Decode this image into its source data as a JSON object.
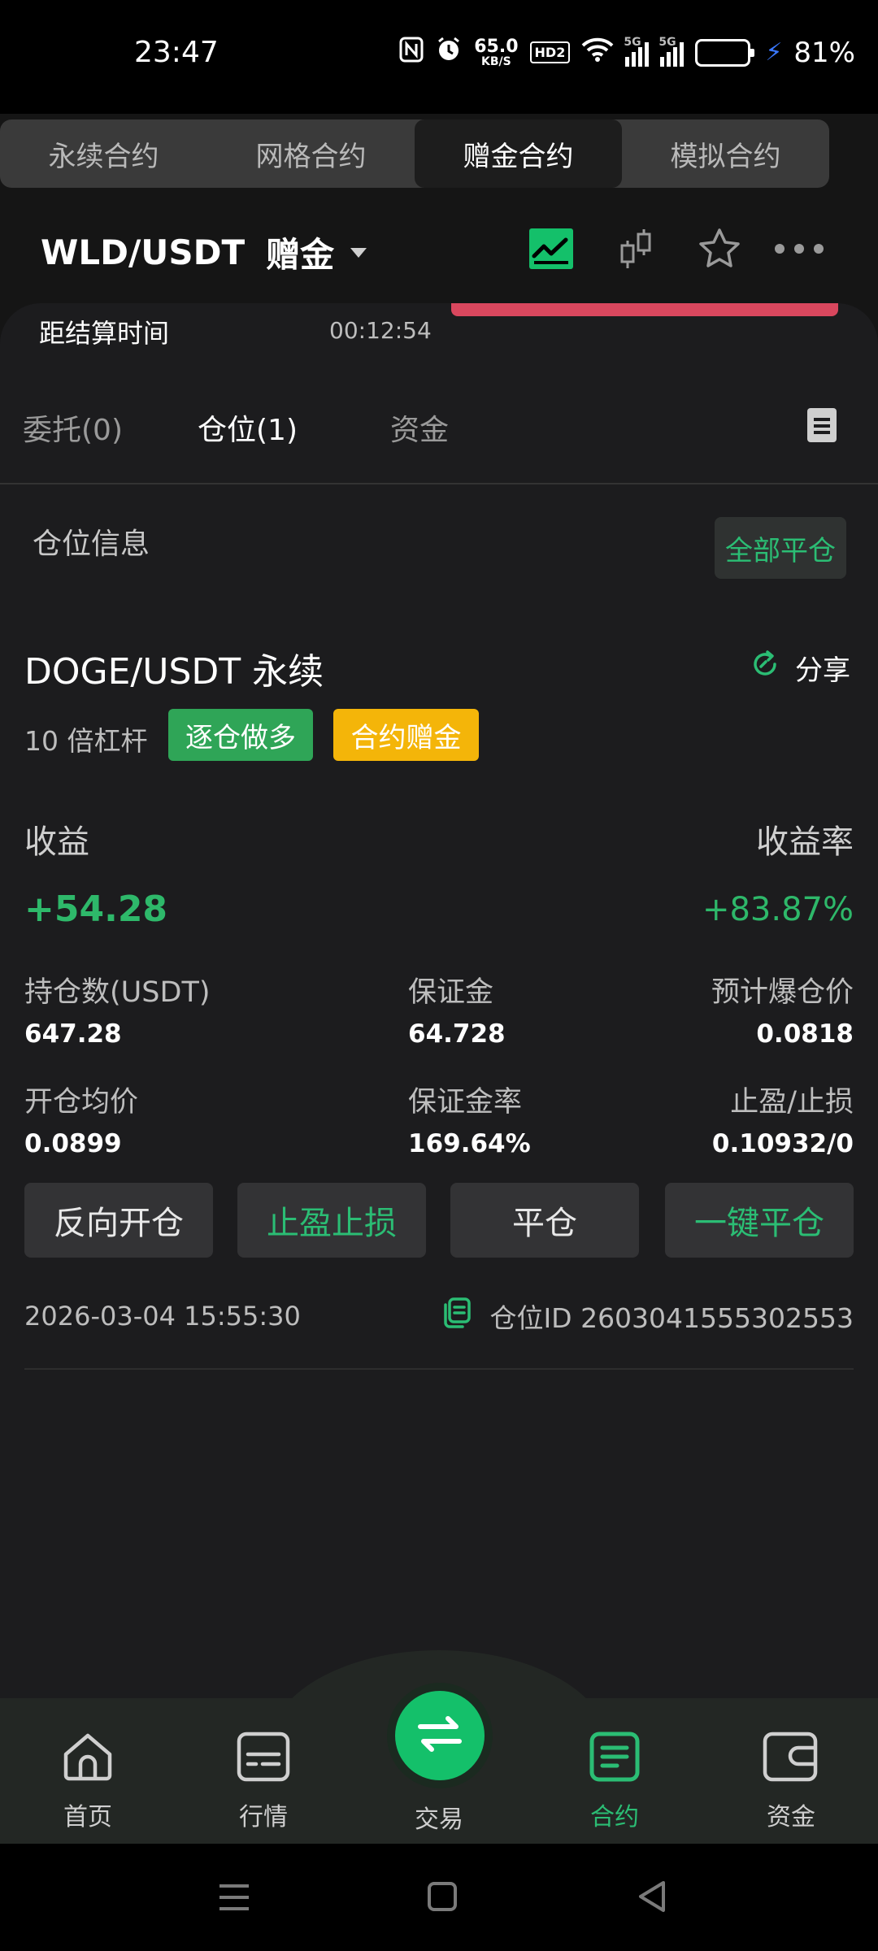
{
  "status_bar": {
    "time": "23:47",
    "net_speed": "65.0",
    "net_unit": "KB/S",
    "hd": "HD2",
    "sig1": "5G",
    "sig2": "5G",
    "battery_pct_text": "81%",
    "battery_level": 0.81,
    "battery_color": "#e7b215"
  },
  "contract_tabs": [
    {
      "label": "永续合约",
      "active": false
    },
    {
      "label": "网格合约",
      "active": false
    },
    {
      "label": "赠金合约",
      "active": true
    },
    {
      "label": "模拟合约",
      "active": false
    }
  ],
  "header": {
    "pair": "WLD/USDT",
    "mode": "赠金",
    "icons": [
      "chart-line-icon",
      "candlestick-icon",
      "star-icon",
      "more-icon"
    ]
  },
  "settlement": {
    "label": "距结算时间",
    "countdown": "00:12:54"
  },
  "sub_tabs": [
    {
      "label": "委托(0)",
      "active": false
    },
    {
      "label": "仓位(1)",
      "active": true
    },
    {
      "label": "资金",
      "active": false
    }
  ],
  "position_section": {
    "title": "仓位信息",
    "close_all": "全部平仓"
  },
  "position": {
    "symbol": "DOGE/USDT 永续",
    "share": "分享",
    "leverage": "10 倍杠杆",
    "tag_direction": "逐仓做多",
    "tag_bonus": "合约赠金",
    "pnl_label": "收益",
    "pnl_rate_label": "收益率",
    "pnl": "+54.28",
    "pnl_rate": "+83.87%",
    "size_label": "持仓数(USDT)",
    "size": "647.28",
    "margin_label": "保证金",
    "margin": "64.728",
    "liq_label": "预计爆仓价",
    "liq": "0.0818",
    "entry_label": "开仓均价",
    "entry": "0.0899",
    "margin_rate_label": "保证金率",
    "margin_rate": "169.64%",
    "tpsl_label": "止盈/止损",
    "tpsl": "0.10932/0",
    "buttons": {
      "reverse": "反向开仓",
      "tpsl": "止盈止损",
      "close": "平仓",
      "close_all": "一键平仓"
    },
    "timestamp": "2026-03-04 15:55:30",
    "position_id": "仓位ID 2603041555302553"
  },
  "bottom_nav": [
    {
      "label": "首页",
      "icon": "home-icon",
      "active": false
    },
    {
      "label": "行情",
      "icon": "market-icon",
      "active": false
    },
    {
      "label": "交易",
      "icon": "swap-icon",
      "active": false
    },
    {
      "label": "合约",
      "icon": "contract-icon",
      "active": true
    },
    {
      "label": "资金",
      "icon": "wallet-icon",
      "active": false
    }
  ],
  "colors": {
    "accent_green": "#2bbd74",
    "tag_green": "#2fa557",
    "tag_yellow": "#f4b509",
    "alert_red": "#d9475e"
  }
}
